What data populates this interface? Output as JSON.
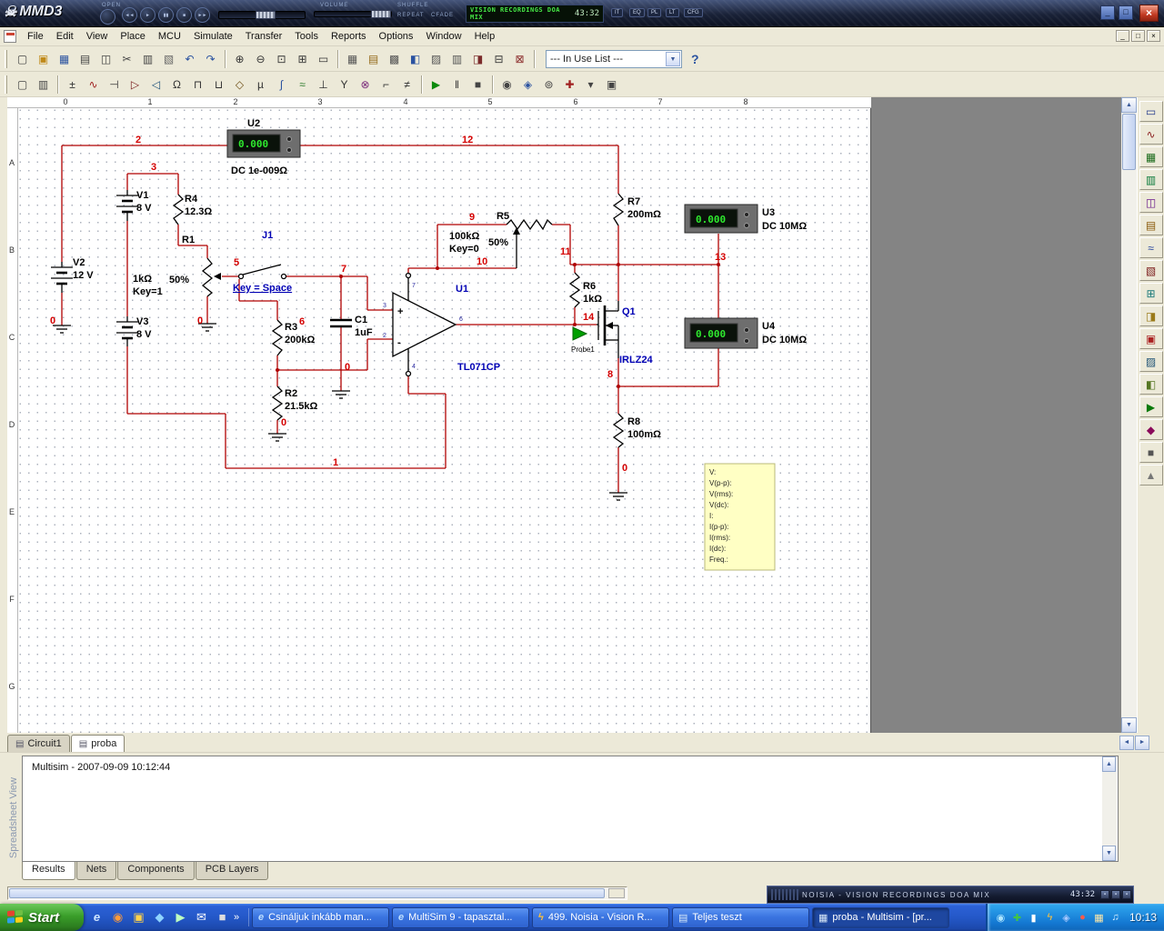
{
  "winamp_top": {
    "skull": "☠",
    "logo": "MMD3",
    "open_label": "OPEN",
    "transport": [
      {
        "g": "◄◄"
      },
      {
        "g": "►"
      },
      {
        "g": "▮▮"
      },
      {
        "g": "■"
      },
      {
        "g": "►►"
      }
    ],
    "volume_label": "VOLUME",
    "shuffle_label": "SHUFFLE",
    "repeat_label": "REPEAT",
    "cfade_label": "CFADE",
    "display_text": "VISION RECORDINGS DOA MIX",
    "display_time": "43:32",
    "chips": [
      {
        "t": "IT"
      },
      {
        "t": "EQ"
      },
      {
        "t": "PL"
      },
      {
        "t": "LT"
      },
      {
        "t": "CFG"
      }
    ],
    "btn_min": "_",
    "btn_max": "□",
    "btn_close": "×"
  },
  "menubar": {
    "menus": [
      {
        "t": "File"
      },
      {
        "t": "Edit"
      },
      {
        "t": "View"
      },
      {
        "t": "Place"
      },
      {
        "t": "MCU"
      },
      {
        "t": "Simulate"
      },
      {
        "t": "Transfer"
      },
      {
        "t": "Tools"
      },
      {
        "t": "Reports"
      },
      {
        "t": "Options"
      },
      {
        "t": "Window"
      },
      {
        "t": "Help"
      }
    ],
    "min": "_",
    "restore": "□",
    "close": "×"
  },
  "toolbar1": {
    "std": [
      {
        "g": "▢",
        "s": "color:#444"
      },
      {
        "g": "▣",
        "s": "color:#c08a1a"
      },
      {
        "g": "▦",
        "s": "color:#2a52a0"
      },
      {
        "g": "▤",
        "s": "color:#444"
      },
      {
        "g": "◫",
        "s": "color:#444"
      },
      {
        "g": "✂",
        "s": "color:#444"
      },
      {
        "g": "▥",
        "s": "color:#444"
      },
      {
        "g": "▧",
        "s": "color:#666"
      },
      {
        "g": "↶",
        "s": "color:#2a52a0"
      },
      {
        "g": "↷",
        "s": "color:#2a52a0"
      }
    ],
    "zoom": [
      {
        "g": "⊕",
        "s": "color:#333"
      },
      {
        "g": "⊖",
        "s": "color:#333"
      },
      {
        "g": "⊡",
        "s": "color:#333"
      },
      {
        "g": "⊞",
        "s": "color:#333"
      },
      {
        "g": "▭",
        "s": "color:#333"
      }
    ],
    "view": [
      {
        "g": "▦",
        "s": "color:#555"
      },
      {
        "g": "▤",
        "s": "color:#946a1a"
      },
      {
        "g": "▩",
        "s": "color:#555"
      },
      {
        "g": "◧",
        "s": "color:#2a52a0"
      },
      {
        "g": "▨",
        "s": "color:#555"
      },
      {
        "g": "▥",
        "s": "color:#555"
      },
      {
        "g": "◨",
        "s": "color:#7a2a2a"
      },
      {
        "g": "⊟",
        "s": "color:#333"
      },
      {
        "g": "⊠",
        "s": "color:#8a2a2a"
      }
    ],
    "in_use_list": "--- In Use List ---",
    "combo_arrow": "▼",
    "help": "?"
  },
  "toolbar2": {
    "left": [
      {
        "g": "▢",
        "s": "color:#444"
      },
      {
        "g": "▥",
        "s": "color:#444"
      }
    ],
    "comp": [
      {
        "g": "±",
        "s": "color:#333"
      },
      {
        "g": "∿",
        "s": "color:#a02020"
      },
      {
        "g": "⊣",
        "s": "color:#333"
      },
      {
        "g": "▷",
        "s": "color:#7a2020"
      },
      {
        "g": "◁",
        "s": "color:#20527a"
      },
      {
        "g": "Ω",
        "s": "color:#333"
      },
      {
        "g": "⊓",
        "s": "color:#333"
      },
      {
        "g": "⊔",
        "s": "color:#333"
      },
      {
        "g": "◇",
        "s": "color:#6a4a10"
      },
      {
        "g": "µ",
        "s": "color:#333"
      },
      {
        "g": "∫",
        "s": "color:#2a52a0"
      },
      {
        "g": "≈",
        "s": "color:#2a7a2a"
      },
      {
        "g": "⊥",
        "s": "color:#333"
      },
      {
        "g": "Y",
        "s": "color:#333"
      },
      {
        "g": "⊗",
        "s": "color:#7a2a7a"
      },
      {
        "g": "⌐",
        "s": "color:#333"
      },
      {
        "g": "≠",
        "s": "color:#333"
      }
    ],
    "play": {
      "g": "▶",
      "s": "color:#0c8a0c"
    },
    "pause": {
      "g": "‖",
      "s": "color:#333"
    },
    "stop": {
      "g": "■",
      "s": "color:#444"
    },
    "post": [
      {
        "g": "◉",
        "s": "color:#444"
      },
      {
        "g": "◈",
        "s": "color:#2a52a0"
      },
      {
        "g": "⊚",
        "s": "color:#444"
      },
      {
        "g": "✚",
        "s": "color:#a02020"
      },
      {
        "g": "▾",
        "s": "color:#444"
      },
      {
        "g": "▣",
        "s": "color:#444"
      }
    ]
  },
  "ruler": {
    "numbers": [
      "0",
      "1",
      "2",
      "3",
      "4",
      "5",
      "6",
      "7",
      "8"
    ],
    "letters": [
      "A",
      "B",
      "C",
      "D",
      "E",
      "F",
      "G"
    ]
  },
  "rtb": {
    "items": [
      {
        "g": "▭",
        "s": "color:#223a8c"
      },
      {
        "g": "∿",
        "s": "color:#8c2222"
      },
      {
        "g": "▦",
        "s": "color:#1a6a1a"
      },
      {
        "g": "▥",
        "s": "color:#0a7a3a"
      },
      {
        "g": "◫",
        "s": "color:#6a1a8a"
      },
      {
        "g": "▤",
        "s": "color:#8a5a0a"
      },
      {
        "g": "≈",
        "s": "color:#1a3a9a"
      },
      {
        "g": "▧",
        "s": "color:#7a1a1a"
      },
      {
        "g": "⊞",
        "s": "color:#1a7a7a"
      },
      {
        "g": "◨",
        "s": "color:#9a7a1a"
      },
      {
        "g": "▣",
        "s": "color:#aa2222"
      },
      {
        "g": "▨",
        "s": "color:#225577"
      },
      {
        "g": "◧",
        "s": "color:#557722"
      },
      {
        "g": "▶",
        "s": "color:#0a7a0a"
      },
      {
        "g": "◆",
        "s": "color:#8a0a5a"
      },
      {
        "g": "■",
        "s": "color:#555555"
      },
      {
        "g": "▲",
        "s": "color:#777777"
      }
    ]
  },
  "circuit": {
    "u2": {
      "name": "U2",
      "reading": "0.000",
      "mode": "DC  1e-009Ω"
    },
    "u3": {
      "name": "U3",
      "reading": "0.000",
      "mode": "DC  10MΩ"
    },
    "u4": {
      "name": "U4",
      "reading": "0.000",
      "mode": "DC  10MΩ"
    },
    "v1": {
      "name": "V1",
      "value": "8 V"
    },
    "v2": {
      "name": "V2",
      "value": "12 V"
    },
    "v3": {
      "name": "V3",
      "value": "8 V"
    },
    "r1": {
      "name": "R1",
      "value": "1kΩ",
      "key": "Key=1",
      "pct": "50%"
    },
    "r2": {
      "name": "R2",
      "value": "21.5kΩ"
    },
    "r3": {
      "name": "R3",
      "value": "200kΩ"
    },
    "r4": {
      "name": "R4",
      "value": "12.3Ω"
    },
    "r5": {
      "name": "R5",
      "value": "100kΩ",
      "key": "Key=0",
      "pct": "50%"
    },
    "r6": {
      "name": "R6",
      "value": "1kΩ"
    },
    "r7": {
      "name": "R7",
      "value": "200mΩ"
    },
    "r8": {
      "name": "R8",
      "value": "100mΩ"
    },
    "c1": {
      "name": "C1",
      "value": "1uF"
    },
    "j1": {
      "name": "J1",
      "key": "Key = Space"
    },
    "u1": {
      "name": "U1",
      "part": "TL071CP",
      "plus": "+",
      "minus": "-",
      "p2": "2",
      "p3": "3",
      "p4": "4",
      "p6": "6",
      "p7": "7"
    },
    "q1": {
      "name": "Q1",
      "part": "IRLZ24"
    },
    "probe_label": "Probe1",
    "nets": {
      "n0": "0",
      "n1": "1",
      "n2": "2",
      "n3": "3",
      "n5": "5",
      "n6": "6",
      "n7": "7",
      "n8": "8",
      "n9": "9",
      "n10": "10",
      "n11": "11",
      "n12": "12",
      "n13": "13",
      "n14": "14"
    },
    "probe_box": [
      "V:",
      "V(p-p):",
      "V(rms):",
      "V(dc):",
      "I:",
      "I(p-p):",
      "I(rms):",
      "I(dc):",
      "Freq.:"
    ]
  },
  "doc_tabs": {
    "tabs": [
      {
        "icon": "▤",
        "label": "Circuit1"
      },
      {
        "icon": "▤",
        "label": "proba"
      }
    ],
    "left_arrow": "◄",
    "right_arrow": "►"
  },
  "spreadsheet": {
    "side_label": "Spreadsheet View",
    "log": "Multisim  -  2007-09-09 10:12:44",
    "tabs": [
      {
        "t": "Results"
      },
      {
        "t": "Nets"
      },
      {
        "t": "Components"
      },
      {
        "t": "PCB Layers"
      }
    ],
    "up": "▲",
    "down": "▼"
  },
  "winamp_shade": {
    "title": "NOISIA - VISION RECORDINGS DOA MIX",
    "time": "43:32",
    "mini": "▪"
  },
  "taskbar": {
    "start_label": "Start",
    "quick": [
      {
        "g": "e",
        "s": "color:#cfe6ff;font-style:italic;font-weight:bold"
      },
      {
        "g": "◉",
        "s": "color:#ff9a3a"
      },
      {
        "g": "▣",
        "s": "color:#ffd24a"
      },
      {
        "g": "◆",
        "s": "color:#8fd4ff"
      },
      {
        "g": "▶",
        "s": "color:#bfffbf"
      },
      {
        "g": "✉",
        "s": "color:#ffffff"
      },
      {
        "g": "■",
        "s": "color:#dddddd"
      }
    ],
    "chevron": "»",
    "tasks": [
      {
        "icon": "e",
        "is": "color:#bfe0ff;font-style:italic;font-weight:bold",
        "label": "Csináljuk inkább man..."
      },
      {
        "icon": "e",
        "is": "color:#bfe0ff;font-style:italic;font-weight:bold",
        "label": "MultiSim 9 - tapasztal..."
      },
      {
        "icon": "ϟ",
        "is": "color:#ffc23a;font-weight:bold",
        "label": "499. Noisia - Vision R..."
      },
      {
        "icon": "▤",
        "is": "color:#d8e8f8",
        "label": "Teljes teszt"
      },
      {
        "icon": "▦",
        "is": "color:#d8e8f8",
        "label": "proba - Multisim - [pr..."
      }
    ],
    "tray": [
      {
        "g": "◉",
        "s": "color:#aee6ff"
      },
      {
        "g": "✚",
        "s": "color:#42c642"
      },
      {
        "g": "▮",
        "s": "color:#ffffff"
      },
      {
        "g": "ϟ",
        "s": "color:#ffc23a"
      },
      {
        "g": "◈",
        "s": "color:#a8c8ff"
      },
      {
        "g": "●",
        "s": "color:#ff5a4a"
      },
      {
        "g": "▦",
        "s": "color:#ffe9a8"
      },
      {
        "g": "♫",
        "s": "color:#d8f0ff"
      }
    ],
    "clock": "10:13"
  }
}
